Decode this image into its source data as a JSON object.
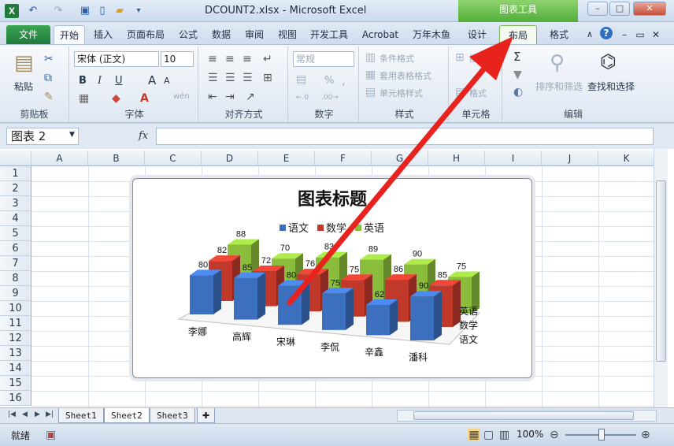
{
  "window": {
    "app_icon": "X",
    "title": "DCOUNT2.xlsx - Microsoft Excel",
    "context_tools": "图表工具",
    "controls": [
      "–",
      "□",
      "✕"
    ],
    "ribbon_controls": [
      "∧",
      "?",
      "–",
      "▭",
      "✕"
    ]
  },
  "tabs": [
    "文件",
    "开始",
    "插入",
    "页面布局",
    "公式",
    "数据",
    "审阅",
    "视图",
    "开发工具",
    "Acrobat",
    "万年木鱼",
    "设计",
    "布局",
    "格式"
  ],
  "ribbon": {
    "clipboard": {
      "paste": "粘贴",
      "label": "剪贴板"
    },
    "font": {
      "name": "宋体 (正文)",
      "size": "10",
      "bold": "B",
      "italic": "I",
      "underline": "U",
      "grow": "A",
      "shrink": "A",
      "wen": "wén",
      "label": "字体"
    },
    "alignment": {
      "label": "对齐方式"
    },
    "number": {
      "format": "常规",
      "percent": "%",
      "comma": ",",
      "label": "数字"
    },
    "styles": {
      "conditional": "条件格式",
      "table": "套用表格格式",
      "cell": "单元格样式",
      "label": "样式"
    },
    "cells": {
      "insert": "插入",
      "format": "格式",
      "label": "单元格"
    },
    "editing": {
      "sigma": "Σ",
      "sort": "排序和筛选",
      "find": "查找和选择",
      "label": "编辑"
    }
  },
  "formula_bar": {
    "name_box": "图表 2",
    "fx": "fx",
    "value": ""
  },
  "columns": [
    "A",
    "B",
    "C",
    "D",
    "E",
    "F",
    "G",
    "H",
    "I",
    "J",
    "K"
  ],
  "rows": [
    "1",
    "2",
    "3",
    "4",
    "5",
    "6",
    "7",
    "8",
    "9",
    "10",
    "11",
    "12",
    "13",
    "14",
    "15",
    "16"
  ],
  "chart_data": {
    "type": "bar",
    "title": "图表标题",
    "categories": [
      "李娜",
      "高辉",
      "宋琳",
      "李侃",
      "辛鑫",
      "潘科"
    ],
    "series": [
      {
        "name": "语文",
        "values": [
          80,
          85,
          80,
          75,
          62,
          90
        ],
        "color": "#3d6fbf"
      },
      {
        "name": "数学",
        "values": [
          82,
          72,
          76,
          75,
          86,
          85
        ],
        "color": "#c0392b"
      },
      {
        "name": "英语",
        "values": [
          88,
          70,
          83,
          89,
          90,
          75
        ],
        "color": "#8bbd3c"
      }
    ],
    "legend": "top",
    "depth_labels": [
      "英语",
      "数学",
      "语文"
    ],
    "grid": false
  },
  "sheets": [
    "Sheet1",
    "Sheet2",
    "Sheet3"
  ],
  "active_sheet": "Sheet2",
  "status": {
    "ready": "就绪",
    "zoom": "100%"
  }
}
